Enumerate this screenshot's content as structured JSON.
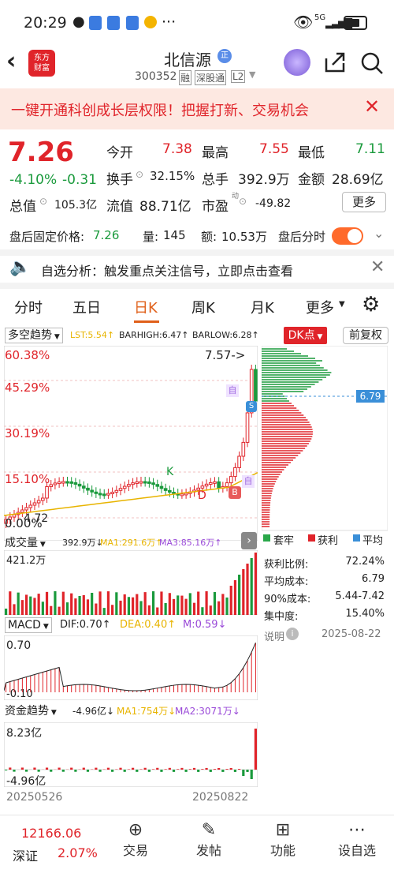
{
  "status": {
    "time": "20:29",
    "dots": "···",
    "network": "5G"
  },
  "header": {
    "logo_line1": "东方",
    "logo_line2": "财富",
    "stock_name": "北信源",
    "stock_badge": "正",
    "code": "300352",
    "tag1": "融",
    "tag2": "深股通",
    "tag3": "L2"
  },
  "banner": {
    "text": "一键开通科创成长层权限！把握打新、交易机会"
  },
  "quote": {
    "price": "7.26",
    "change_pct": "-4.10%",
    "change": "-0.31",
    "open_label": "今开",
    "open": "7.38",
    "high_label": "最高",
    "high": "7.55",
    "low_label": "最低",
    "low": "7.11",
    "turnover_label": "换手",
    "turnover": "32.15%",
    "volume_label": "总手",
    "volume": "392.9万",
    "amount_label": "金额",
    "amount": "28.69亿",
    "mcap_label": "总值",
    "mcap": "105.3亿",
    "float_label": "流值",
    "float": "88.71亿",
    "pe_label": "市盈",
    "pe_sup": "动",
    "pe": "-49.82",
    "more": "更多"
  },
  "afterhours": {
    "price_label": "盘后固定价格:",
    "price": "7.26",
    "qty_label": "量:",
    "qty": "145",
    "amt_label": "额:",
    "amt": "10.53万",
    "timeshare_label": "盘后分时"
  },
  "signal": {
    "text": "自选分析：触发重点关注信号，立即点击查看"
  },
  "tabs": [
    "分时",
    "五日",
    "日K",
    "周K",
    "月K",
    "更多"
  ],
  "active_tab": "日K",
  "kline": {
    "indicator": "多空趋势",
    "lst": "LST:5.54↑",
    "barhigh": "BARHIGH:6.47↑",
    "barlow": "BARLOW:6.28↑",
    "dk": "DK点",
    "adjust": "前复权",
    "pct_labels": [
      "60.38%",
      "45.29%",
      "30.19%",
      "15.10%",
      "0.00%"
    ],
    "high_marker": "7.57->",
    "low_marker": "4.72",
    "tag_zi": "自",
    "tag_s": "S",
    "tag_b": "B",
    "tag_k": "K",
    "tag_d": "D"
  },
  "chip": {
    "price_tag": "6.79",
    "legend": [
      "套牢",
      "获利",
      "平均"
    ],
    "rows": [
      {
        "label": "获利比例:",
        "value": "72.24%"
      },
      {
        "label": "平均成本:",
        "value": "6.79"
      },
      {
        "label": "90%成本:",
        "value": "5.44-7.42"
      },
      {
        "label": "集中度:",
        "value": "15.40%"
      }
    ],
    "note": "说明",
    "date": "2025-08-22"
  },
  "volume": {
    "label": "成交量",
    "vol": "392.9万↓",
    "ma1": "MA1:291.6万↑",
    "ma3": "MA3:85.16万↑",
    "max": "421.2万"
  },
  "macd": {
    "label": "MACD",
    "dif": "DIF:0.70↑",
    "dea": "DEA:0.40↑",
    "m": "M:0.59↓",
    "top": "0.70",
    "bottom": "-0.10"
  },
  "fund": {
    "label": "资金趋势",
    "val": "-4.96亿↓",
    "ma1": "MA1:754万↓",
    "ma2": "MA2:3071万↓",
    "top": "8.23亿",
    "bottom": "-4.96亿"
  },
  "dates": {
    "start": "20250526",
    "end": "20250822"
  },
  "bottom": {
    "index_value": "12166.06",
    "index_name": "深证",
    "index_pct": "2.07%",
    "items": [
      "交易",
      "发帖",
      "功能",
      "设自选"
    ]
  },
  "colors": {
    "up": "#e0242a",
    "down": "#1a9a3c",
    "accent": "#e0242a"
  }
}
